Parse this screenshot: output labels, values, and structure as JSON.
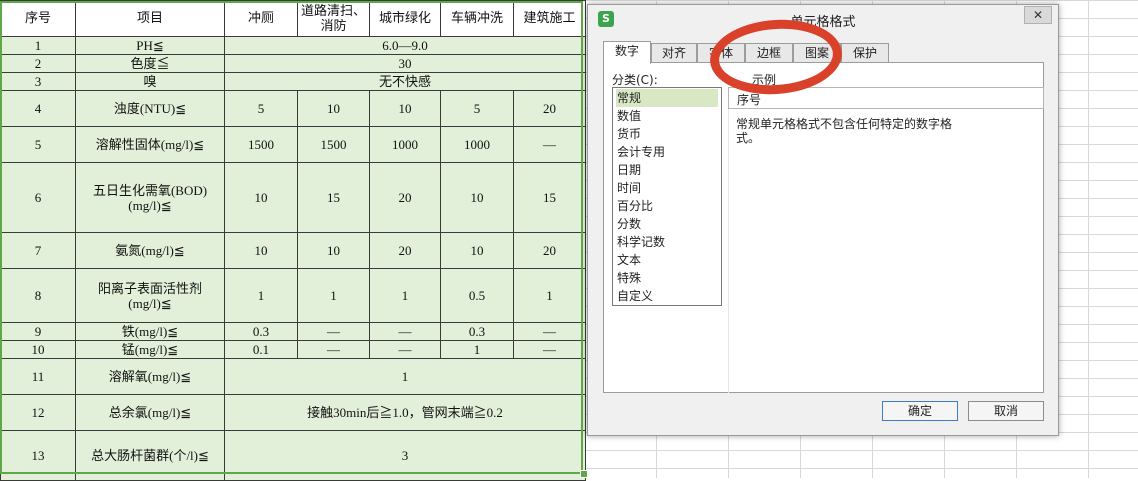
{
  "sheet": {
    "headers": [
      "序号",
      "项目",
      "冲厕",
      "道路清扫、消防",
      "城市绿化",
      "车辆冲洗",
      "建筑施工"
    ],
    "rows": {
      "r1": {
        "no": "1",
        "item": "PH≦",
        "span": "6.0—9.0"
      },
      "r2": {
        "no": "2",
        "item": "色度≦",
        "span": "30"
      },
      "r3": {
        "no": "3",
        "item": "嗅",
        "span": "无不快感"
      },
      "r4": {
        "no": "4",
        "item": "浊度(NTU)≦",
        "vals": [
          "5",
          "10",
          "10",
          "5",
          "20"
        ]
      },
      "r5": {
        "no": "5",
        "item": "溶解性固体(mg/l)≦",
        "vals": [
          "1500",
          "1500",
          "1000",
          "1000",
          "—"
        ]
      },
      "r6": {
        "no": "6",
        "item": "五日生化需氧(BOD)(mg/l)≦",
        "vals": [
          "10",
          "15",
          "20",
          "10",
          "15"
        ]
      },
      "r7": {
        "no": "7",
        "item": "氨氮(mg/l)≦",
        "vals": [
          "10",
          "10",
          "20",
          "10",
          "20"
        ]
      },
      "r8": {
        "no": "8",
        "item": "阳离子表面活性剂(mg/l)≦",
        "vals": [
          "1",
          "1",
          "1",
          "0.5",
          "1"
        ]
      },
      "r9": {
        "no": "9",
        "item": "铁(mg/l)≦",
        "vals": [
          "0.3",
          "—",
          "—",
          "0.3",
          "—"
        ]
      },
      "r10": {
        "no": "10",
        "item": "锰(mg/l)≦",
        "vals": [
          "0.1",
          "—",
          "—",
          "1",
          "—"
        ]
      },
      "r11": {
        "no": "11",
        "item": "溶解氧(mg/l)≦",
        "span": "1"
      },
      "r12": {
        "no": "12",
        "item": "总余氯(mg/l)≦",
        "span": "接触30min后≧1.0，管网末端≧0.2"
      },
      "r13": {
        "no": "13",
        "item": "总大肠杆菌群(个/l)≦",
        "span": "3"
      }
    }
  },
  "dialog": {
    "app_icon": "S",
    "title": "单元格格式",
    "close": "✕",
    "tabs": [
      "数字",
      "对齐",
      "字体",
      "边框",
      "图案",
      "保护"
    ],
    "active_tab": "数字",
    "category_label": "分类(C):",
    "categories": [
      "常规",
      "数值",
      "货币",
      "会计专用",
      "日期",
      "时间",
      "百分比",
      "分数",
      "科学记数",
      "文本",
      "特殊",
      "自定义"
    ],
    "selected_category": "常规",
    "sample_label": "示例",
    "sample_value": "序号",
    "description": "常规单元格格式不包含任何特定的数字格式。",
    "ok": "确定",
    "cancel": "取消"
  },
  "colors": {
    "cell_fill": "#e2f0d9",
    "selection_border": "#5fa84a",
    "annotation": "#d9412a",
    "selected_category_bg": "#d9e8c4"
  }
}
